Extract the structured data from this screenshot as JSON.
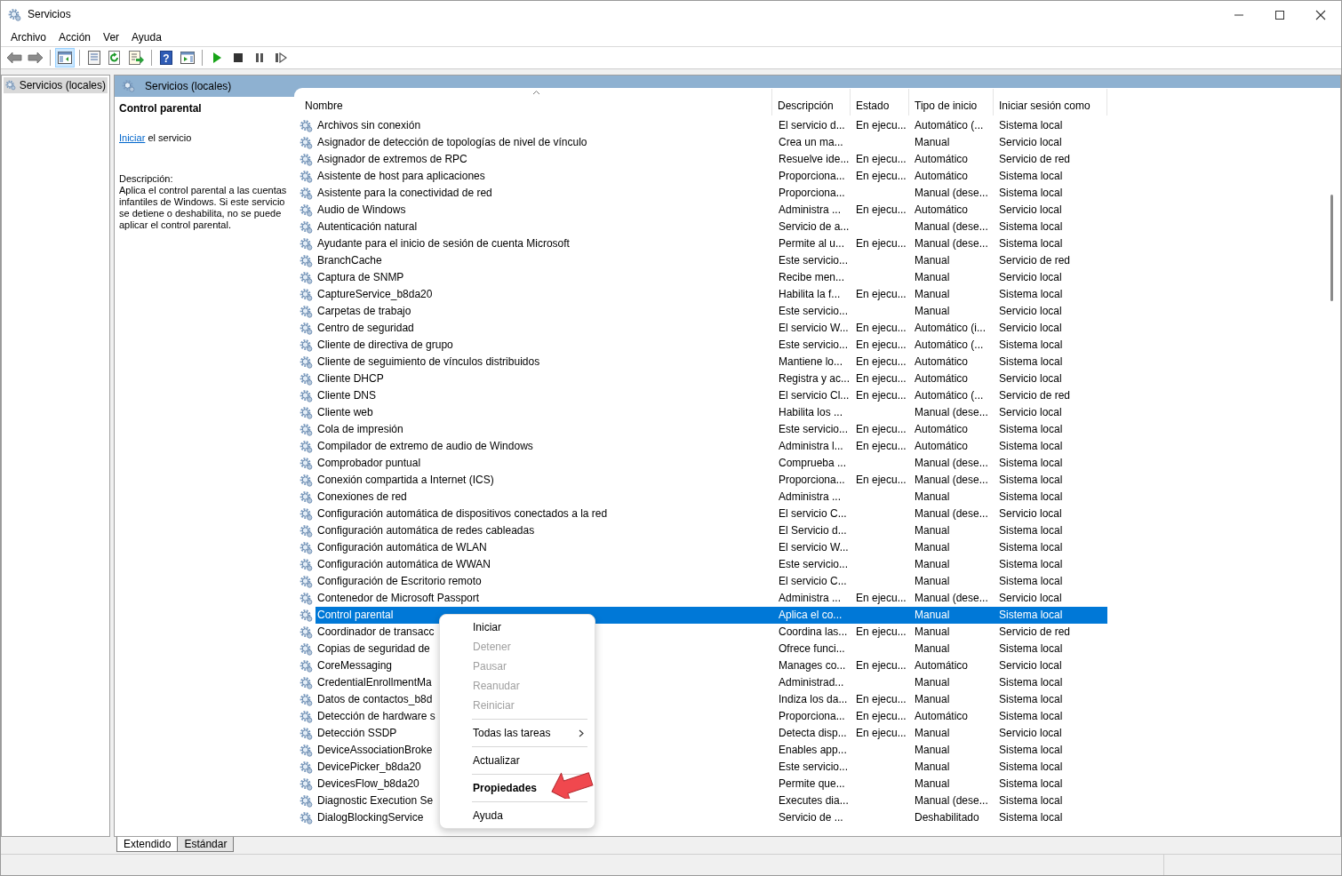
{
  "window": {
    "title": "Servicios"
  },
  "menu": [
    "Archivo",
    "Acción",
    "Ver",
    "Ayuda"
  ],
  "toolbar": [
    {
      "kind": "back",
      "pressed": false
    },
    {
      "kind": "forward",
      "pressed": false
    },
    {
      "kind": "separator"
    },
    {
      "kind": "tree",
      "pressed": true
    },
    {
      "kind": "separator"
    },
    {
      "kind": "properties",
      "pressed": false
    },
    {
      "kind": "refresh",
      "pressed": false
    },
    {
      "kind": "export",
      "pressed": false
    },
    {
      "kind": "separator"
    },
    {
      "kind": "help",
      "pressed": false,
      "glyph": "?"
    },
    {
      "kind": "panel",
      "pressed": false
    },
    {
      "kind": "separator"
    },
    {
      "kind": "play",
      "pressed": false
    },
    {
      "kind": "stop",
      "pressed": false
    },
    {
      "kind": "pause",
      "pressed": false
    },
    {
      "kind": "resume",
      "pressed": false
    }
  ],
  "tree": [
    {
      "label": "Servicios (locales)",
      "selected": true
    }
  ],
  "pane_header": "Servicios (locales)",
  "details": {
    "title": "Control parental",
    "action_link": "Iniciar",
    "action_text": " el servicio",
    "description_label": "Descripción:",
    "description": "Aplica el control parental a las cuentas infantiles de Windows. Si este servicio se detiene o deshabilita, no se puede aplicar el control parental."
  },
  "table": {
    "columns": [
      {
        "label": "Nombre",
        "sorted": true
      },
      {
        "label": "Descripción",
        "sorted": false
      },
      {
        "label": "Estado",
        "sorted": false
      },
      {
        "label": "Tipo de inicio",
        "sorted": false
      },
      {
        "label": "Iniciar sesión como",
        "sorted": false
      }
    ],
    "rows": [
      {
        "name": "Archivos sin conexión",
        "description": "El servicio d...",
        "status": "En ejecu...",
        "startup": "Automático (...",
        "logon": "Sistema local",
        "selected": false
      },
      {
        "name": "Asignador de detección de topologías de nivel de vínculo",
        "description": "Crea un ma...",
        "startup": "Manual",
        "logon": "Servicio local",
        "selected": false
      },
      {
        "name": "Asignador de extremos de RPC",
        "description": "Resuelve ide...",
        "status": "En ejecu...",
        "startup": "Automático",
        "logon": "Servicio de red",
        "selected": false
      },
      {
        "name": "Asistente de host para aplicaciones",
        "description": "Proporciona...",
        "status": "En ejecu...",
        "startup": "Automático",
        "logon": "Sistema local",
        "selected": false
      },
      {
        "name": "Asistente para la conectividad de red",
        "description": "Proporciona...",
        "startup": "Manual (dese...",
        "logon": "Sistema local",
        "selected": false
      },
      {
        "name": "Audio de Windows",
        "description": "Administra ...",
        "status": "En ejecu...",
        "startup": "Automático",
        "logon": "Servicio local",
        "selected": false
      },
      {
        "name": "Autenticación natural",
        "description": "Servicio de a...",
        "startup": "Manual (dese...",
        "logon": "Sistema local",
        "selected": false
      },
      {
        "name": "Ayudante para el inicio de sesión de cuenta Microsoft",
        "description": "Permite al u...",
        "status": "En ejecu...",
        "startup": "Manual (dese...",
        "logon": "Sistema local",
        "selected": false
      },
      {
        "name": "BranchCache",
        "description": "Este servicio...",
        "startup": "Manual",
        "logon": "Servicio de red",
        "selected": false
      },
      {
        "name": "Captura de SNMP",
        "description": "Recibe men...",
        "startup": "Manual",
        "logon": "Servicio local",
        "selected": false
      },
      {
        "name": "CaptureService_b8da20",
        "description": "Habilita la f...",
        "status": "En ejecu...",
        "startup": "Manual",
        "logon": "Sistema local",
        "selected": false
      },
      {
        "name": "Carpetas de trabajo",
        "description": "Este servicio...",
        "startup": "Manual",
        "logon": "Servicio local",
        "selected": false
      },
      {
        "name": "Centro de seguridad",
        "description": "El servicio W...",
        "status": "En ejecu...",
        "startup": "Automático (i...",
        "logon": "Servicio local",
        "selected": false
      },
      {
        "name": "Cliente de directiva de grupo",
        "description": "Este servicio...",
        "status": "En ejecu...",
        "startup": "Automático (...",
        "logon": "Sistema local",
        "selected": false
      },
      {
        "name": "Cliente de seguimiento de vínculos distribuidos",
        "description": "Mantiene lo...",
        "status": "En ejecu...",
        "startup": "Automático",
        "logon": "Sistema local",
        "selected": false
      },
      {
        "name": "Cliente DHCP",
        "description": "Registra y ac...",
        "status": "En ejecu...",
        "startup": "Automático",
        "logon": "Servicio local",
        "selected": false
      },
      {
        "name": "Cliente DNS",
        "description": "El servicio Cl...",
        "status": "En ejecu...",
        "startup": "Automático (...",
        "logon": "Servicio de red",
        "selected": false
      },
      {
        "name": "Cliente web",
        "description": "Habilita los ...",
        "startup": "Manual (dese...",
        "logon": "Servicio local",
        "selected": false
      },
      {
        "name": "Cola de impresión",
        "description": "Este servicio...",
        "status": "En ejecu...",
        "startup": "Automático",
        "logon": "Sistema local",
        "selected": false
      },
      {
        "name": "Compilador de extremo de audio de Windows",
        "description": "Administra l...",
        "status": "En ejecu...",
        "startup": "Automático",
        "logon": "Sistema local",
        "selected": false
      },
      {
        "name": "Comprobador puntual",
        "description": "Comprueba ...",
        "startup": "Manual (dese...",
        "logon": "Sistema local",
        "selected": false
      },
      {
        "name": "Conexión compartida a Internet (ICS)",
        "description": "Proporciona...",
        "status": "En ejecu...",
        "startup": "Manual (dese...",
        "logon": "Sistema local",
        "selected": false
      },
      {
        "name": "Conexiones de red",
        "description": "Administra ...",
        "startup": "Manual",
        "logon": "Sistema local",
        "selected": false
      },
      {
        "name": "Configuración automática de dispositivos conectados a la red",
        "description": "El servicio C...",
        "startup": "Manual (dese...",
        "logon": "Servicio local",
        "selected": false
      },
      {
        "name": "Configuración automática de redes cableadas",
        "description": "El Servicio d...",
        "startup": "Manual",
        "logon": "Sistema local",
        "selected": false
      },
      {
        "name": "Configuración automática de WLAN",
        "description": "El servicio W...",
        "startup": "Manual",
        "logon": "Sistema local",
        "selected": false
      },
      {
        "name": "Configuración automática de WWAN",
        "description": "Este servicio...",
        "startup": "Manual",
        "logon": "Sistema local",
        "selected": false
      },
      {
        "name": "Configuración de Escritorio remoto",
        "description": "El servicio C...",
        "startup": "Manual",
        "logon": "Sistema local",
        "selected": false
      },
      {
        "name": "Contenedor de Microsoft Passport",
        "description": "Administra ...",
        "status": "En ejecu...",
        "startup": "Manual (dese...",
        "logon": "Servicio local",
        "selected": false
      },
      {
        "name": "Control parental",
        "description": "Aplica el co...",
        "startup": "Manual",
        "logon": "Sistema local",
        "selected": true
      },
      {
        "name": "Coordinador de transacc",
        "description": "Coordina las...",
        "status": "En ejecu...",
        "startup": "Manual",
        "logon": "Servicio de red",
        "selected": false
      },
      {
        "name": "Copias de seguridad de",
        "description": "Ofrece funci...",
        "startup": "Manual",
        "logon": "Sistema local",
        "selected": false
      },
      {
        "name": "CoreMessaging",
        "description": "Manages co...",
        "status": "En ejecu...",
        "startup": "Automático",
        "logon": "Servicio local",
        "selected": false
      },
      {
        "name": "CredentialEnrollmentMa",
        "description": "Administrad...",
        "startup": "Manual",
        "logon": "Sistema local",
        "selected": false
      },
      {
        "name": "Datos de contactos_b8d",
        "description": "Indiza los da...",
        "status": "En ejecu...",
        "startup": "Manual",
        "logon": "Sistema local",
        "selected": false
      },
      {
        "name": "Detección de hardware s",
        "description": "Proporciona...",
        "status": "En ejecu...",
        "startup": "Automático",
        "logon": "Sistema local",
        "selected": false
      },
      {
        "name": "Detección SSDP",
        "description": "Detecta disp...",
        "status": "En ejecu...",
        "startup": "Manual",
        "logon": "Servicio local",
        "selected": false
      },
      {
        "name": "DeviceAssociationBroke",
        "description": "Enables app...",
        "startup": "Manual",
        "logon": "Sistema local",
        "selected": false
      },
      {
        "name": "DevicePicker_b8da20",
        "description": "Este servicio...",
        "startup": "Manual",
        "logon": "Sistema local",
        "selected": false
      },
      {
        "name": "DevicesFlow_b8da20",
        "description": "Permite que...",
        "startup": "Manual",
        "logon": "Sistema local",
        "selected": false
      },
      {
        "name": "Diagnostic Execution Se",
        "description": "Executes dia...",
        "startup": "Manual (dese...",
        "logon": "Sistema local",
        "selected": false
      },
      {
        "name": "DialogBlockingService",
        "description": "Servicio de ...",
        "startup": "Deshabilitado",
        "logon": "Sistema local",
        "selected": false
      }
    ]
  },
  "context_menu": {
    "items": [
      {
        "kind": "item",
        "label": "Iniciar",
        "disabled": false,
        "default": false
      },
      {
        "kind": "item",
        "label": "Detener",
        "disabled": true,
        "default": false
      },
      {
        "kind": "item",
        "label": "Pausar",
        "disabled": true,
        "default": false
      },
      {
        "kind": "item",
        "label": "Reanudar",
        "disabled": true,
        "default": false
      },
      {
        "kind": "item",
        "label": "Reiniciar",
        "disabled": true,
        "default": false
      },
      {
        "kind": "separator"
      },
      {
        "kind": "submenu",
        "label": "Todas las tareas",
        "disabled": false,
        "default": false
      },
      {
        "kind": "separator"
      },
      {
        "kind": "item",
        "label": "Actualizar",
        "disabled": false,
        "default": false
      },
      {
        "kind": "separator"
      },
      {
        "kind": "item",
        "label": "Propiedades",
        "disabled": false,
        "default": true,
        "marker": {
          "kind": "arrow"
        }
      },
      {
        "kind": "separator"
      },
      {
        "kind": "item",
        "label": "Ayuda",
        "disabled": false,
        "default": false
      }
    ]
  },
  "tabs": [
    {
      "label": "Extendido",
      "selected": true
    },
    {
      "label": "Estándar",
      "selected": false
    }
  ]
}
